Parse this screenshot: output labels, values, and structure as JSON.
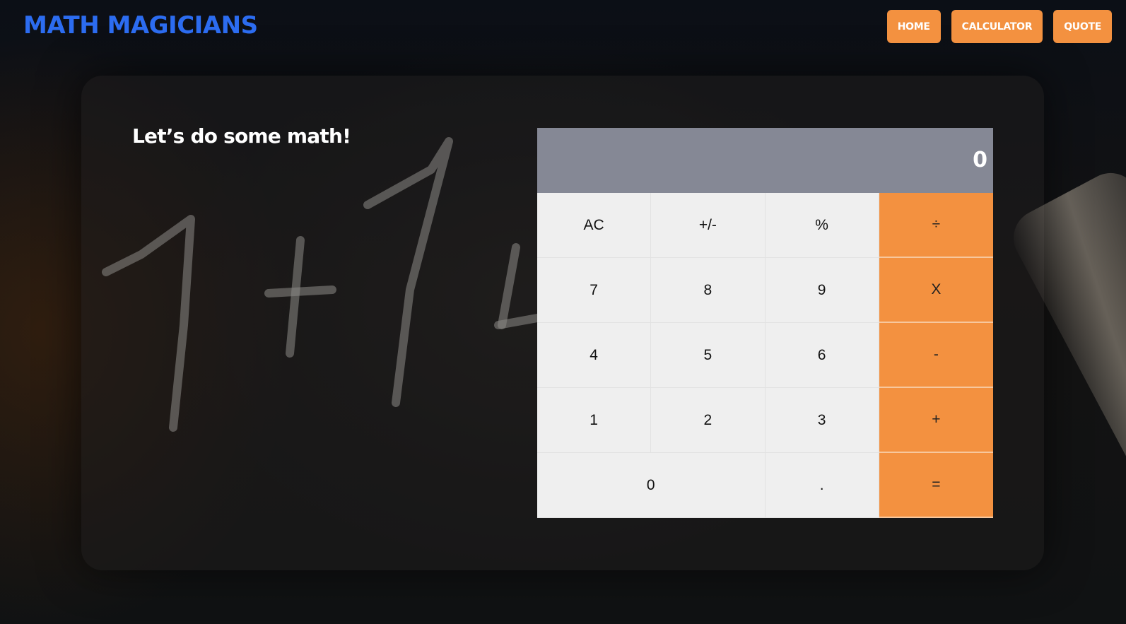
{
  "header": {
    "logo": "MATH MAGICIANS",
    "nav": [
      "HOME",
      "CALCULATOR",
      "QUOTE"
    ]
  },
  "main": {
    "heading": "Let’s do some math!"
  },
  "calculator": {
    "display": "0",
    "keys": {
      "ac": "AC",
      "sign": "+/-",
      "percent": "%",
      "divide": "÷",
      "seven": "7",
      "eight": "8",
      "nine": "9",
      "multiply": "X",
      "four": "4",
      "five": "5",
      "six": "6",
      "minus": "-",
      "one": "1",
      "two": "2",
      "three": "3",
      "plus": "+",
      "zero": "0",
      "decimal": ".",
      "equals": "="
    }
  },
  "colors": {
    "accent": "#f39140",
    "logo": "#2c6cf0",
    "display_bg": "#858895",
    "key_bg": "#efefef"
  }
}
